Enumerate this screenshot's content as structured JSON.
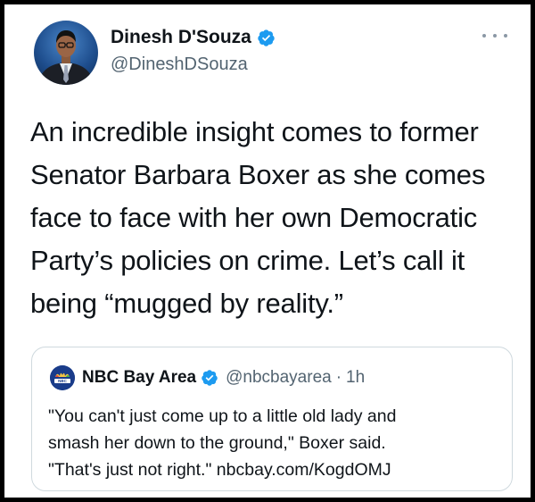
{
  "tweet": {
    "author_name": "Dinesh D'Souza",
    "author_handle": "@DineshDSouza",
    "verified": true,
    "text_lines": [
      "An incredible insight comes to former",
      "Senator Barbara Boxer as she comes",
      "face to face with her own Democratic",
      "Party’s policies on crime. Let’s call it",
      "being “mugged by reality.”"
    ]
  },
  "quote": {
    "logo_label": "NBC",
    "author_name": "NBC Bay Area",
    "verified": true,
    "author_handle": "@nbcbayarea",
    "separator": "·",
    "timestamp": "1h",
    "text_lines": [
      "\"You can't just come up to a little old lady and",
      "smash her down to the ground,\" Boxer said.",
      "\"That's just not right.\" nbcbay.com/KogdOMJ"
    ]
  },
  "icons": {
    "verified": "verified-badge-icon",
    "more": "more-options-icon"
  },
  "colors": {
    "verified": "#1d9bf0",
    "text": "#0f1419",
    "secondary_text": "#536471",
    "border": "#cfd9de"
  }
}
